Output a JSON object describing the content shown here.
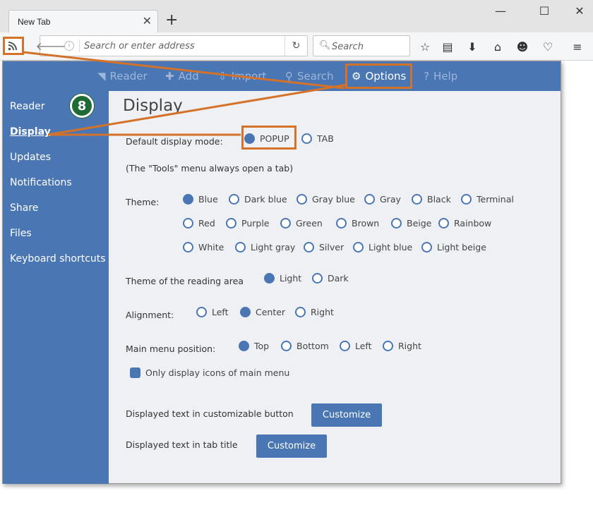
{
  "browser": {
    "tab_title": "New Tab",
    "address_placeholder": "Search or enter address",
    "search_placeholder": "Search"
  },
  "menu": {
    "items": [
      {
        "label": "Reader",
        "icon": "rss-icon"
      },
      {
        "label": "Add",
        "icon": "plus-icon"
      },
      {
        "label": "Import",
        "icon": "import-icon"
      },
      {
        "label": "Search",
        "icon": "search-icon"
      },
      {
        "label": "Options",
        "icon": "gear-icon",
        "active": true
      },
      {
        "label": "Help",
        "icon": "question-icon"
      }
    ]
  },
  "sidebar": {
    "items": [
      {
        "label": "Reader"
      },
      {
        "label": "Display",
        "active": true
      },
      {
        "label": "Updates"
      },
      {
        "label": "Notifications"
      },
      {
        "label": "Share"
      },
      {
        "label": "Files"
      },
      {
        "label": "Keyboard shortcuts"
      }
    ],
    "step_badge": "8"
  },
  "content": {
    "title": "Display",
    "display_mode_label": "Default display mode:",
    "display_modes": [
      {
        "label": "POPUP",
        "selected": true
      },
      {
        "label": "TAB",
        "selected": false
      }
    ],
    "tools_note": "(The \"Tools\" menu always open a tab)",
    "theme_label": "Theme:",
    "themes": [
      {
        "label": "Blue",
        "selected": true
      },
      {
        "label": "Dark blue"
      },
      {
        "label": "Gray blue"
      },
      {
        "label": "Gray"
      },
      {
        "label": "Black"
      },
      {
        "label": "Terminal"
      },
      {
        "label": "Red"
      },
      {
        "label": "Purple"
      },
      {
        "label": "Green"
      },
      {
        "label": "Brown"
      },
      {
        "label": "Beige"
      },
      {
        "label": "Rainbow"
      },
      {
        "label": "White"
      },
      {
        "label": "Light gray"
      },
      {
        "label": "Silver"
      },
      {
        "label": "Light blue"
      },
      {
        "label": "Light beige"
      }
    ],
    "reading_area_label": "Theme of the reading area",
    "reading_area": [
      {
        "label": "Light",
        "selected": true
      },
      {
        "label": "Dark"
      }
    ],
    "alignment_label": "Alignment:",
    "alignment": [
      {
        "label": "Left"
      },
      {
        "label": "Center",
        "selected": true
      },
      {
        "label": "Right"
      }
    ],
    "menu_position_label": "Main menu position:",
    "menu_position": [
      {
        "label": "Top",
        "selected": true
      },
      {
        "label": "Bottom"
      },
      {
        "label": "Left"
      },
      {
        "label": "Right"
      }
    ],
    "icons_only_label": "Only display icons of main menu",
    "icons_only_checked": true,
    "custom_button_label": "Displayed text in customizable button",
    "tab_title_label": "Displayed text in tab title",
    "customize_label": "Customize"
  },
  "colors": {
    "accent": "#4a77b4",
    "highlight": "#d4722a",
    "badge": "#1f6a35"
  }
}
